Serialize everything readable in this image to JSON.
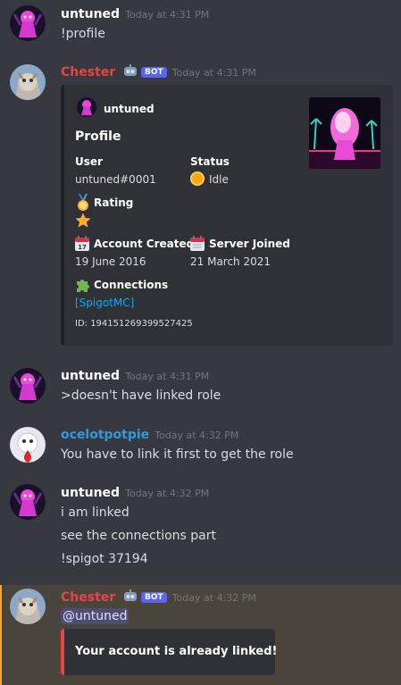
{
  "messages": [
    {
      "author": "untuned",
      "timestamp": "Today at 4:31 PM",
      "lines": [
        "!profile"
      ]
    },
    {
      "author": "Chester",
      "bot_badge": "BOT",
      "timestamp": "Today at 4:31 PM"
    },
    {
      "author": "untuned",
      "timestamp": "Today at 4:31 PM",
      "lines": [
        ">doesn't have linked role"
      ]
    },
    {
      "author": "ocelotpotpie",
      "timestamp": "Today at 4:32 PM",
      "lines": [
        "You have to link it first to get the role"
      ]
    },
    {
      "author": "untuned",
      "timestamp": "Today at 4:32 PM",
      "lines": [
        "i am linked",
        "see the connections part",
        "!spigot 37194"
      ]
    },
    {
      "author": "Chester",
      "bot_badge": "BOT",
      "timestamp": "Today at 4:32 PM",
      "mention": "@untuned"
    }
  ],
  "profile_embed": {
    "author": "untuned",
    "title": "Profile",
    "user_label": "User",
    "user_value": "untuned#0001",
    "status_label": "Status",
    "status_value": "Idle",
    "rating_label": "Rating",
    "rating_stars": 1,
    "account_created_label": "Account Created",
    "account_created_value": "19 June 2016",
    "server_joined_label": "Server Joined",
    "server_joined_value": "21 March 2021",
    "connections_label": "Connections",
    "connections_link": "[SpigotMC]",
    "footer": "ID: 194151269399527425"
  },
  "linked_embed": {
    "description": "Your account is already linked!"
  },
  "colors": {
    "background": "#36393f",
    "embed_bg": "#2f3136",
    "bot_name": "#ed4245",
    "ocelot_name": "#3498db",
    "link": "#00aff4",
    "bot_badge": "#5865f2",
    "highlight_bg": "#49443c",
    "error_bar": "#ed4245",
    "idle": "#faa81a"
  },
  "icons": {
    "rating": "medal-icon",
    "star": "star-icon",
    "created": "calendar-icon",
    "joined": "calendar-icon",
    "connections": "puzzle-piece-icon",
    "status": "idle-dot-icon"
  }
}
